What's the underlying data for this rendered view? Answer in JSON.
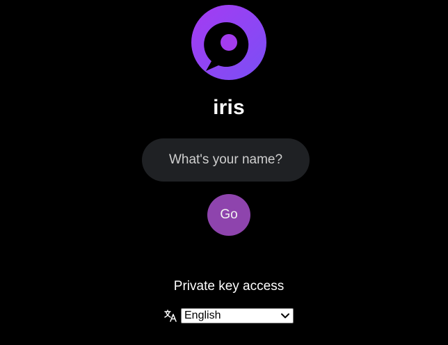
{
  "app": {
    "title": "iris",
    "logo_icon": "iris-logo-icon"
  },
  "login": {
    "name_placeholder": "What's your name?",
    "name_value": "",
    "go_label": "Go",
    "private_key_label": "Private key access"
  },
  "language": {
    "icon": "translate-icon",
    "selected": "English"
  },
  "colors": {
    "background": "#000000",
    "input_background": "#1f2124",
    "go_button": "#8e44ad",
    "logo_gradient_start": "#9b36f0",
    "logo_gradient_end": "#6a5cf5"
  }
}
